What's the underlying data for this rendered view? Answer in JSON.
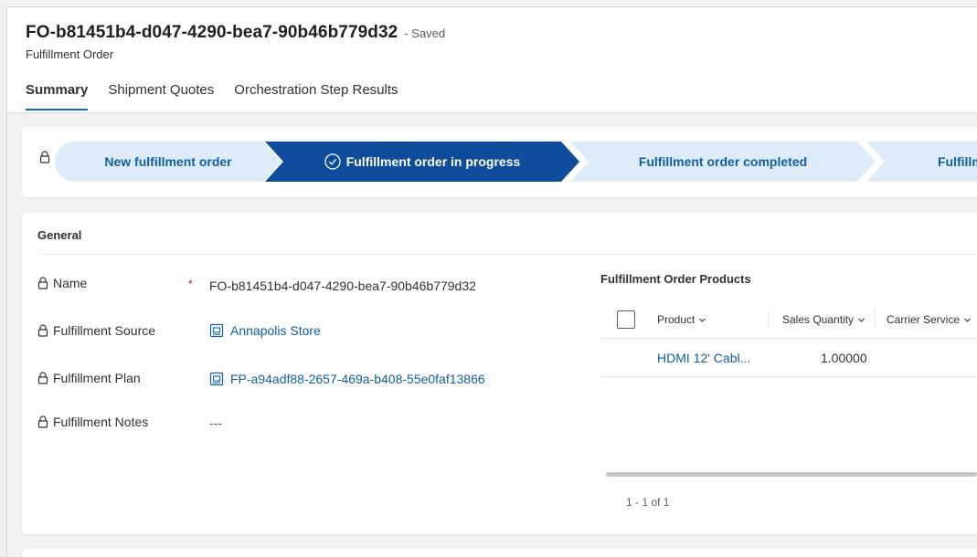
{
  "header": {
    "record_title": "FO-b81451b4-d047-4290-bea7-90b46b779d32",
    "saved_status": "- Saved",
    "entity_name": "Fulfillment Order",
    "tabs": [
      {
        "label": "Summary",
        "active": true
      },
      {
        "label": "Shipment Quotes",
        "active": false
      },
      {
        "label": "Orchestration Step Results",
        "active": false
      }
    ]
  },
  "process": {
    "lock_icon": "lock-icon",
    "stages": [
      {
        "label": "New fulfillment order",
        "state": "completed"
      },
      {
        "label": "Fulfillment order in progress",
        "state": "active",
        "icon": "check-circle-icon"
      },
      {
        "label": "Fulfillment order completed",
        "state": "upcoming"
      },
      {
        "label": "Fulfillm",
        "state": "upcoming"
      }
    ],
    "colors": {
      "active": "#0f4c9b",
      "inactive": "#deecf9",
      "inactive_text": "#115ea3"
    }
  },
  "general": {
    "section_title": "General",
    "fields": [
      {
        "label": "Name",
        "value": "FO-b81451b4-d047-4290-bea7-90b46b779d32",
        "required": true,
        "required_mark": "*"
      },
      {
        "label": "Fulfillment Source",
        "value": "Annapolis Store",
        "is_link": true
      },
      {
        "label": "Fulfillment Plan",
        "value": "FP-a94adf88-2657-469a-b408-55e0faf13866",
        "is_link": true
      },
      {
        "label": "Fulfillment Notes",
        "value": "---"
      }
    ],
    "products_grid": {
      "title": "Fulfillment Order Products",
      "columns": [
        "Product",
        "Sales Quantity",
        "Carrier Service"
      ],
      "rows": [
        {
          "product": "HDMI 12' Cabl...",
          "sales_quantity": "1.00000",
          "carrier_service": ""
        }
      ],
      "pager": "1 - 1 of 1"
    }
  },
  "colors": {
    "accent": "#0f6cbd",
    "link": "#115ea3",
    "required": "#c50f1f"
  }
}
